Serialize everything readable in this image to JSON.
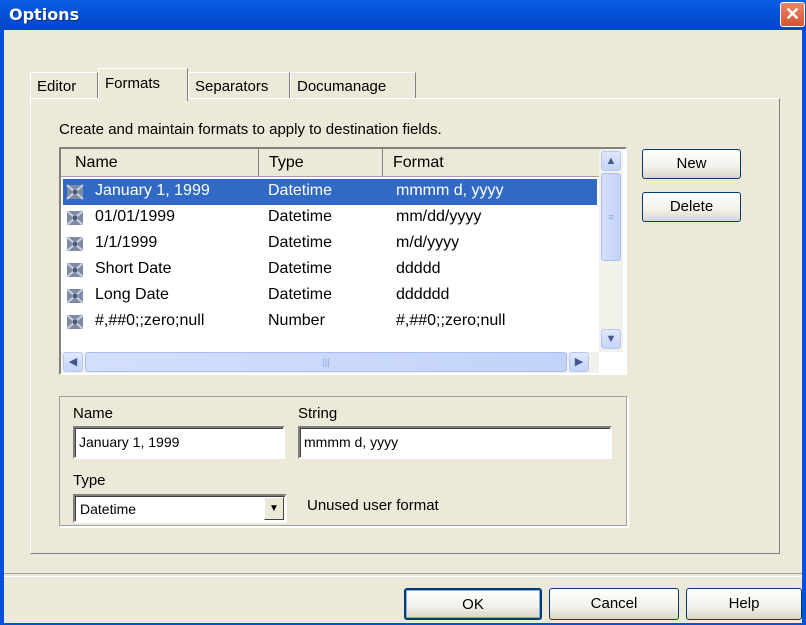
{
  "window": {
    "title": "Options",
    "close_glyph": "✕"
  },
  "tabs": [
    {
      "label": "Editor",
      "active": false
    },
    {
      "label": "Formats",
      "active": true
    },
    {
      "label": "Separators",
      "active": false
    },
    {
      "label": "Documanage",
      "active": false
    }
  ],
  "panel": {
    "description": "Create and maintain formats to apply to destination fields.",
    "columns": [
      "Name",
      "Type",
      "Format"
    ],
    "rows": [
      {
        "name": "January 1, 1999",
        "type": "Datetime",
        "format": "mmmm d, yyyy",
        "selected": true
      },
      {
        "name": "01/01/1999",
        "type": "Datetime",
        "format": "mm/dd/yyyy",
        "selected": false
      },
      {
        "name": "1/1/1999",
        "type": "Datetime",
        "format": "m/d/yyyy",
        "selected": false
      },
      {
        "name": "Short Date",
        "type": "Datetime",
        "format": "ddddd",
        "selected": false
      },
      {
        "name": "Long Date",
        "type": "Datetime",
        "format": "dddddd",
        "selected": false
      },
      {
        "name": "#,##0;;zero;null",
        "type": "Number",
        "format": "#,##0;;zero;null",
        "selected": false
      }
    ],
    "buttons": {
      "new": "New",
      "delete": "Delete"
    }
  },
  "details": {
    "name_label": "Name",
    "name_value": "January 1, 1999",
    "string_label": "String",
    "string_value": "mmmm d, yyyy",
    "type_label": "Type",
    "type_value": "Datetime",
    "status": "Unused user format"
  },
  "footer": {
    "ok": "OK",
    "cancel": "Cancel",
    "help": "Help"
  },
  "colors": {
    "titlebar": "#0551d9",
    "selection": "#316ac5",
    "face": "#ece9d8"
  }
}
